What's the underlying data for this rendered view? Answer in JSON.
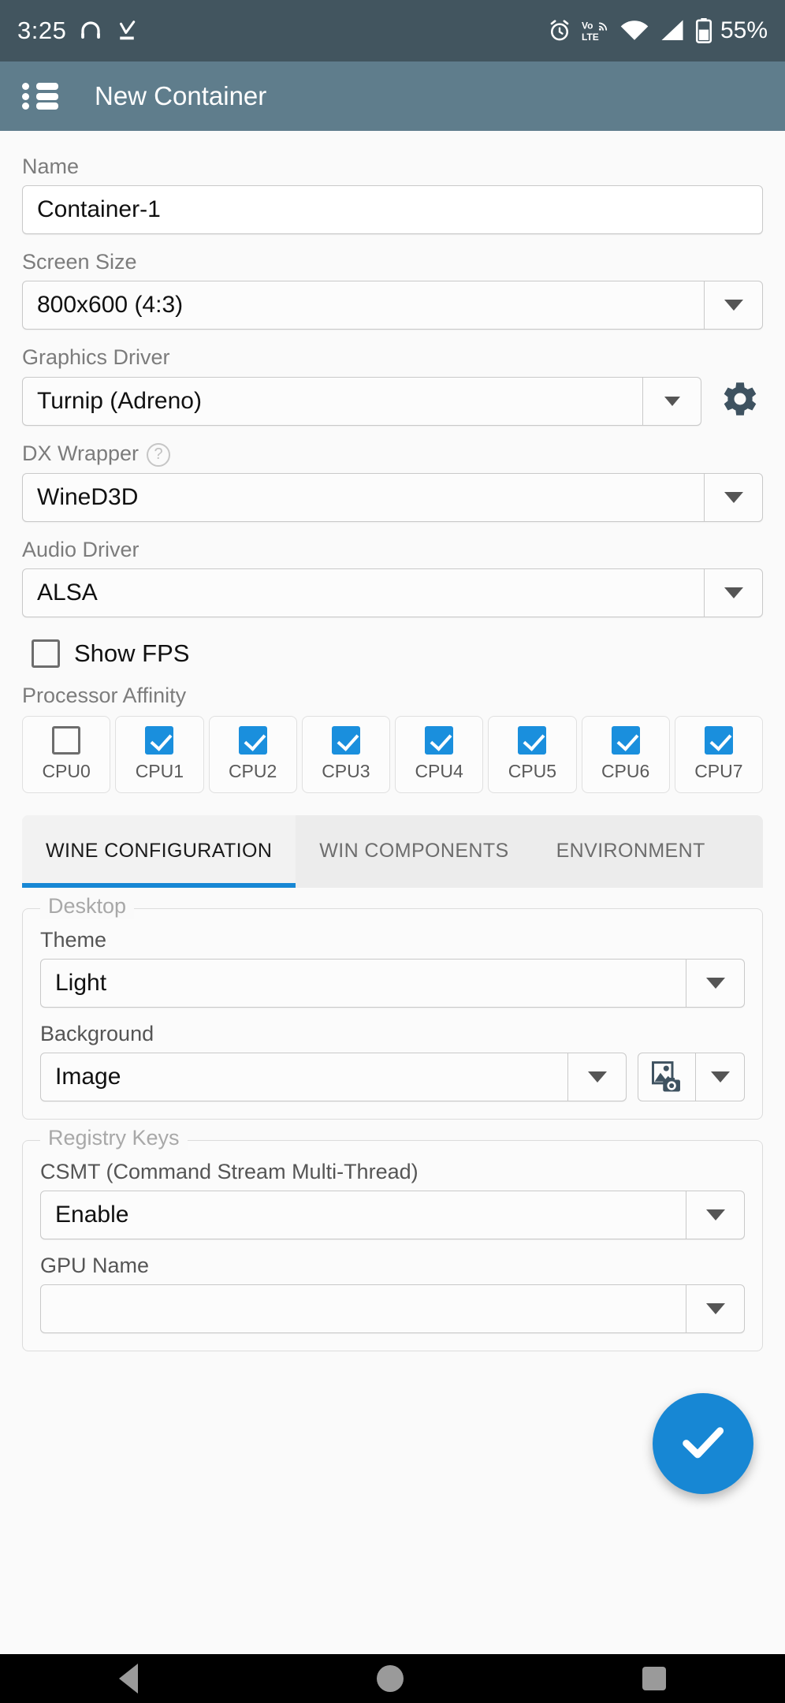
{
  "statusbar": {
    "clock": "3:25",
    "battery_percent": "55%",
    "icons": [
      "headset-icon",
      "download-complete-icon",
      "alarm-icon",
      "volte-icon",
      "wifi-icon",
      "cellular-signal-icon",
      "battery-icon"
    ]
  },
  "appbar": {
    "menu_icon": "list-menu-icon",
    "title": "New Container",
    "background": "#5f7d8c"
  },
  "form": {
    "name": {
      "label": "Name",
      "value": "Container-1"
    },
    "screen_size": {
      "label": "Screen Size",
      "value": "800x600 (4:3)"
    },
    "graphics_driver": {
      "label": "Graphics Driver",
      "value": "Turnip (Adreno)",
      "settings_icon": "gear-icon"
    },
    "dx_wrapper": {
      "label": "DX Wrapper",
      "value": "WineD3D",
      "help_icon": "help-question-icon",
      "help_glyph": "?"
    },
    "audio_driver": {
      "label": "Audio Driver",
      "value": "ALSA"
    },
    "show_fps": {
      "label": "Show FPS",
      "checked": false
    }
  },
  "processor_affinity": {
    "label": "Processor Affinity",
    "cpus": [
      {
        "label": "CPU0",
        "checked": false
      },
      {
        "label": "CPU1",
        "checked": true
      },
      {
        "label": "CPU2",
        "checked": true
      },
      {
        "label": "CPU3",
        "checked": true
      },
      {
        "label": "CPU4",
        "checked": true
      },
      {
        "label": "CPU5",
        "checked": true
      },
      {
        "label": "CPU6",
        "checked": true
      },
      {
        "label": "CPU7",
        "checked": true
      }
    ]
  },
  "tabs": {
    "items": [
      {
        "label": "WINE CONFIGURATION",
        "active": true
      },
      {
        "label": "WIN COMPONENTS",
        "active": false
      },
      {
        "label": "ENVIRONMENT",
        "active": false
      }
    ],
    "active_indicator_color": "#1787d4"
  },
  "desktop_section": {
    "legend": "Desktop",
    "theme": {
      "label": "Theme",
      "value": "Light"
    },
    "background": {
      "label": "Background",
      "value": "Image",
      "picker_icon": "image-camera-picker-icon"
    }
  },
  "registry_section": {
    "legend": "Registry Keys",
    "csmt": {
      "label": "CSMT (Command Stream Multi-Thread)",
      "value": "Enable"
    },
    "gpu_name": {
      "label": "GPU Name"
    }
  },
  "fab": {
    "icon": "check-icon",
    "color": "#1787d4"
  },
  "navbar": {
    "back": "back-triangle-icon",
    "home": "home-circle-icon",
    "recents": "recents-square-icon"
  }
}
